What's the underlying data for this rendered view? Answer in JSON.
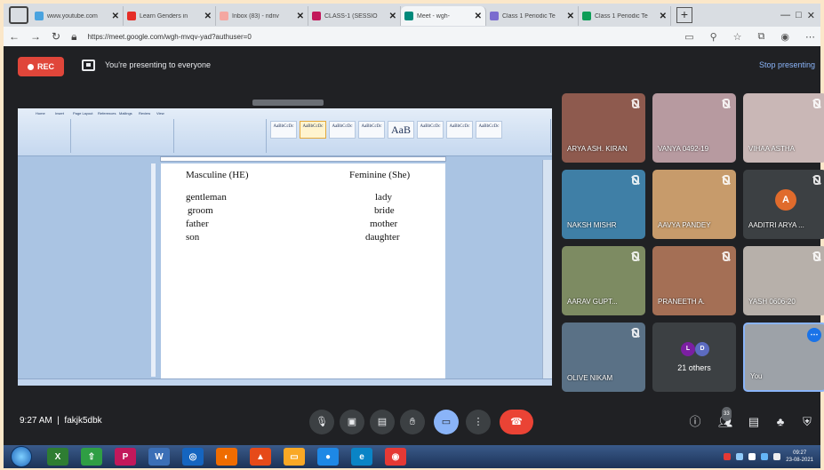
{
  "browser": {
    "tabs": [
      {
        "title": "www.youtube.com",
        "fav_color": "#4aa3df",
        "active": false
      },
      {
        "title": "Learn Genders in",
        "fav_color": "#e52d27",
        "active": false
      },
      {
        "title": "Inbox (83) - ndnv",
        "fav_color": "#f4a7a1",
        "active": false
      },
      {
        "title": "CLASS-1 (SESSIO",
        "fav_color": "#c2185b",
        "active": false
      },
      {
        "title": "Meet - wgh-",
        "fav_color": "#00897b",
        "active": true
      },
      {
        "title": "Class 1 Periodic Te",
        "fav_color": "#7b6ccf",
        "active": false
      },
      {
        "title": "Class 1 Periodic Te",
        "fav_color": "#0f9d58",
        "active": false
      }
    ],
    "url": "https://meet.google.com/wgh-mvqv-yad?authuser=0"
  },
  "meet": {
    "rec_label": "REC",
    "presenting_text": "You're presenting to everyone",
    "stop_presenting": "Stop presenting",
    "meeting_time": "9:27 AM",
    "meeting_code": "fakjk5dbk",
    "participants": [
      {
        "name": "ARYA ASH. KIRAN",
        "bg": "#8e5a4e"
      },
      {
        "name": "VANYA 0492-19",
        "bg": "#b79aa0"
      },
      {
        "name": "VIHAA ASTHA",
        "bg": "#c9b7b6"
      },
      {
        "name": "NAKSH MISHR",
        "bg": "#3f7fa6"
      },
      {
        "name": "AAVYA PANDEY",
        "bg": "#c79b6b"
      },
      {
        "name": "AADITRI ARYA ...",
        "bg": "#3c4043",
        "initial": "A"
      },
      {
        "name": "AARAV GUPT...",
        "bg": "#7d8b62"
      },
      {
        "name": "PRANEETH A.",
        "bg": "#a46f55"
      },
      {
        "name": "YASH 0606-20",
        "bg": "#b7b0aa"
      },
      {
        "name": "OLIVE NIKAM",
        "bg": "#5a7186"
      },
      {
        "name": "21 others",
        "bg": "#3c4043"
      },
      {
        "name": "You",
        "bg": "#9da2a8"
      }
    ],
    "others_initials": [
      "L",
      "D"
    ],
    "participant_count": "33"
  },
  "document": {
    "ribbon_tabs": [
      "Home",
      "Insert",
      "Page Layout",
      "References",
      "Mailings",
      "Review",
      "View"
    ],
    "style_sample": "AaBbCcDc",
    "style_big": "AaB",
    "heading_masculine": "Masculine (HE)",
    "heading_feminine": "Feminine (She)",
    "masculine": [
      "gentleman",
      "groom",
      "father",
      "son"
    ],
    "feminine": [
      "lady",
      "bride",
      "mother",
      "daughter"
    ]
  },
  "taskbar": {
    "clock_time": "09:27",
    "clock_date": "23-08-2021"
  }
}
